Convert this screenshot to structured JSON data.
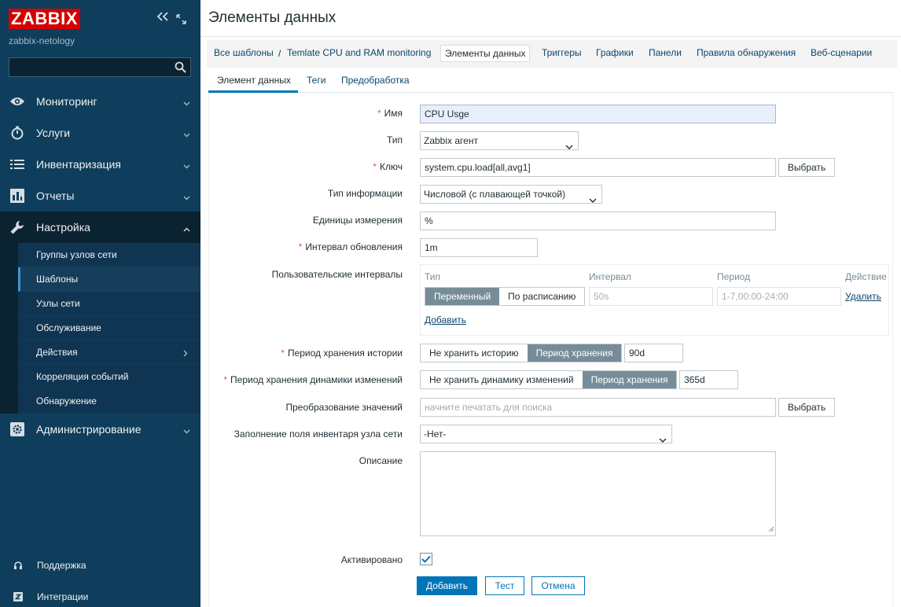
{
  "sidebar": {
    "logo": "ZABBIX",
    "instance_name": "zabbix-netology",
    "search": {
      "value": "",
      "placeholder": ""
    },
    "menu": [
      {
        "label": "Мониторинг",
        "icon": "eye-icon"
      },
      {
        "label": "Услуги",
        "icon": "stopwatch-icon"
      },
      {
        "label": "Инвентаризация",
        "icon": "list-icon"
      },
      {
        "label": "Отчеты",
        "icon": "bar-chart-icon"
      },
      {
        "label": "Настройка",
        "icon": "wrench-icon"
      },
      {
        "label": "Администрирование",
        "icon": "gear-icon"
      }
    ],
    "submenu": [
      {
        "label": "Группы узлов сети"
      },
      {
        "label": "Шаблоны"
      },
      {
        "label": "Узлы сети"
      },
      {
        "label": "Обслуживание"
      },
      {
        "label": "Действия"
      },
      {
        "label": "Корреляция событий"
      },
      {
        "label": "Обнаружение"
      }
    ],
    "footer": [
      {
        "label": "Поддержка",
        "icon": "headset-icon"
      },
      {
        "label": "Интеграции",
        "icon": "integrations-z-icon"
      }
    ]
  },
  "page": {
    "title": "Элементы данных"
  },
  "nav": {
    "breadcrumb_root": "Все шаблоны",
    "separator": "/",
    "template": "Temlate CPU and RAM monitoring",
    "tabs": [
      "Элементы данных",
      "Триггеры",
      "Графики",
      "Панели",
      "Правила обнаружения",
      "Веб-сценарии"
    ]
  },
  "form_tabs": [
    "Элемент данных",
    "Теги",
    "Предобработка"
  ],
  "form": {
    "required_mark": "*",
    "name": {
      "label": "Имя",
      "value": "CPU Usge"
    },
    "type": {
      "label": "Тип",
      "value": "Zabbix агент"
    },
    "key": {
      "label": "Ключ",
      "value": "system.cpu.load[all,avg1]",
      "button": "Выбрать"
    },
    "info_type": {
      "label": "Тип информации",
      "value": "Числовой (с плавающей точкой)"
    },
    "units": {
      "label": "Единицы измерения",
      "value": "%"
    },
    "update_interval": {
      "label": "Интервал обновления",
      "value": "1m"
    },
    "custom_intervals": {
      "label": "Пользовательские интервалы",
      "headers": [
        "Тип",
        "Интервал",
        "Период",
        "Действие"
      ],
      "row": {
        "type_options": [
          "Переменный",
          "По расписанию"
        ],
        "interval_placeholder": "50s",
        "period_placeholder": "1-7,00:00-24:00",
        "remove": "Удалить"
      },
      "add": "Добавить"
    },
    "history": {
      "label": "Период хранения истории",
      "options": [
        "Не хранить историю",
        "Период хранения"
      ],
      "value": "90d"
    },
    "trends": {
      "label": "Период хранения динамики изменений",
      "options": [
        "Не хранить динамику изменений",
        "Период хранения"
      ],
      "value": "365d"
    },
    "valuemap": {
      "label": "Преобразование значений",
      "placeholder": "начните печатать для поиска",
      "button": "Выбрать"
    },
    "inventory": {
      "label": "Заполнение поля инвентаря узла сети",
      "value": "-Нет-"
    },
    "description": {
      "label": "Описание",
      "value": ""
    },
    "enabled": {
      "label": "Активировано",
      "checked": true
    },
    "buttons": {
      "add": "Добавить",
      "test": "Тест",
      "cancel": "Отмена"
    }
  },
  "colors": {
    "accent": "#0275b8",
    "sidebar": "#0e3e5c",
    "logo": "#d40000",
    "required": "#e45959",
    "segment_on": "#768d99"
  }
}
